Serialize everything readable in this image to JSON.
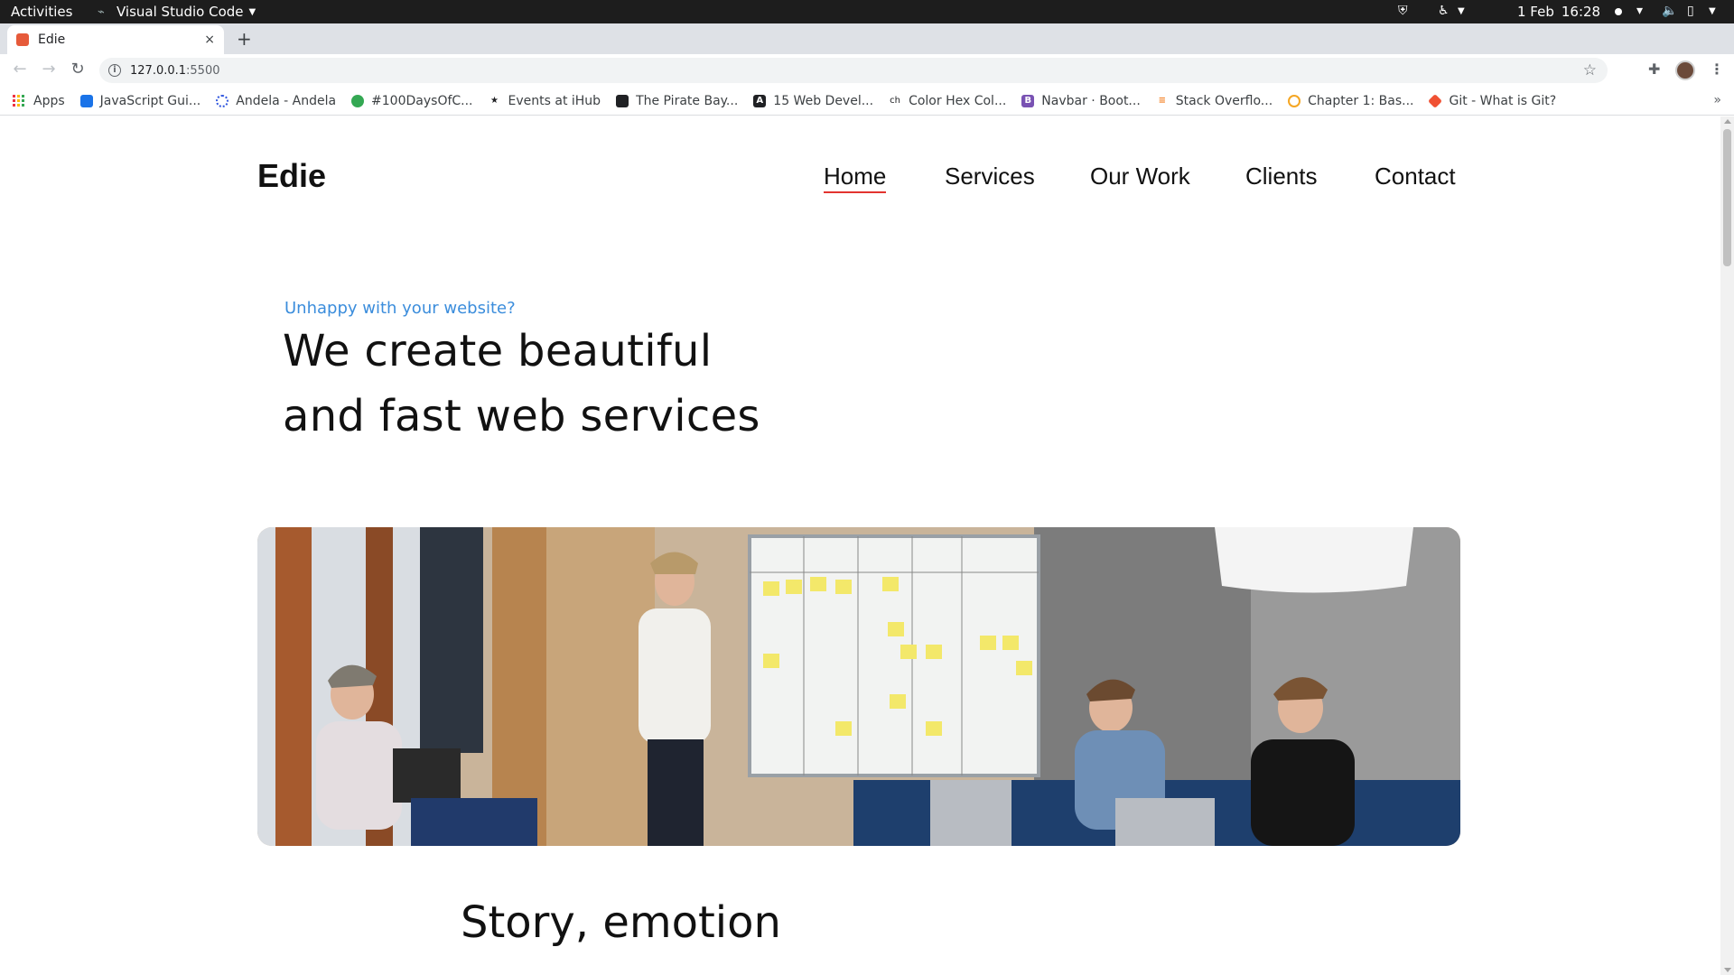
{
  "system_bar": {
    "activities": "Activities",
    "app_name": "Visual Studio Code",
    "date": "1 Feb",
    "time": "16:28"
  },
  "browser": {
    "tab_title": "Edie",
    "url_host": "127.0.0.1",
    "url_port": ":5500",
    "new_tab_symbol": "+",
    "close_tab_symbol": "×"
  },
  "bookmarks": [
    {
      "label": "Apps",
      "icon": "apps-grid-icon"
    },
    {
      "label": "JavaScript Gui...",
      "icon": "javascript-guide-icon",
      "color": "#1a73e8"
    },
    {
      "label": "Andela - Andela",
      "icon": "andela-icon",
      "color": "#3359df"
    },
    {
      "label": "#100DaysOfC...",
      "icon": "100days-icon",
      "color": "#34a853"
    },
    {
      "label": "Events at iHub",
      "icon": "ihub-icon",
      "color": "#202124"
    },
    {
      "label": "The Pirate Bay...",
      "icon": "pirate-bay-icon",
      "color": "#202124"
    },
    {
      "label": "15 Web Devel...",
      "icon": "web-devel-icon",
      "color": "#202124"
    },
    {
      "label": "Color Hex Col...",
      "icon": "color-hex-icon",
      "color": "#202124"
    },
    {
      "label": "Navbar · Boot...",
      "icon": "bootstrap-icon",
      "color": "#7952b3"
    },
    {
      "label": "Stack Overflo...",
      "icon": "stackoverflow-icon",
      "color": "#f48024"
    },
    {
      "label": "Chapter 1: Bas...",
      "icon": "chapter-icon",
      "color": "#f5a623"
    },
    {
      "label": "Git - What is Git?",
      "icon": "git-icon",
      "color": "#f05133"
    }
  ],
  "site": {
    "logo": "Edie",
    "nav": [
      {
        "label": "Home",
        "active": true
      },
      {
        "label": "Services",
        "active": false
      },
      {
        "label": "Our Work",
        "active": false
      },
      {
        "label": "Clients",
        "active": false
      },
      {
        "label": "Contact",
        "active": false
      }
    ],
    "eyebrow": "Unhappy with your website?",
    "headline_line1": "We create beautiful",
    "headline_line2": "and fast web services",
    "hero_alt": "Team meeting in front of a whiteboard",
    "section_title": "Story, emotion"
  },
  "colors": {
    "accent_blue": "#3b8ddc",
    "nav_underline": "#e3342f"
  }
}
